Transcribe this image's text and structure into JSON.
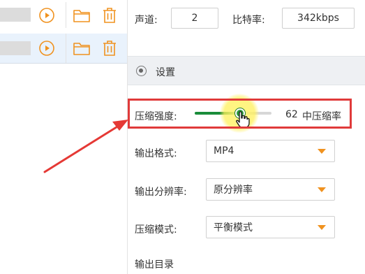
{
  "audio": {
    "channel_label": "声道:",
    "channel_value": "2",
    "bitrate_label": "比特率:",
    "bitrate_value": "342kbps"
  },
  "settings_section": {
    "title": "设置"
  },
  "compression": {
    "label": "压缩强度:",
    "value": 62,
    "value_text": "62",
    "level_text": "中压缩率"
  },
  "output_format": {
    "label": "输出格式:",
    "selected": "MP4"
  },
  "output_resolution": {
    "label": "输出分辨率:",
    "selected": "原分辨率"
  },
  "compression_mode": {
    "label": "压缩模式:",
    "selected": "平衡模式"
  },
  "output_directory": {
    "label": "输出目录"
  },
  "colors": {
    "accent_orange": "#f0921f",
    "slider_green": "#1a8c3a",
    "highlight_red": "#e03a3a",
    "arrow_red": "#e53935",
    "selected_row": "#e9f2fc"
  },
  "icons": {
    "row_actions": [
      "play-icon",
      "folder-icon",
      "trash-icon"
    ]
  }
}
